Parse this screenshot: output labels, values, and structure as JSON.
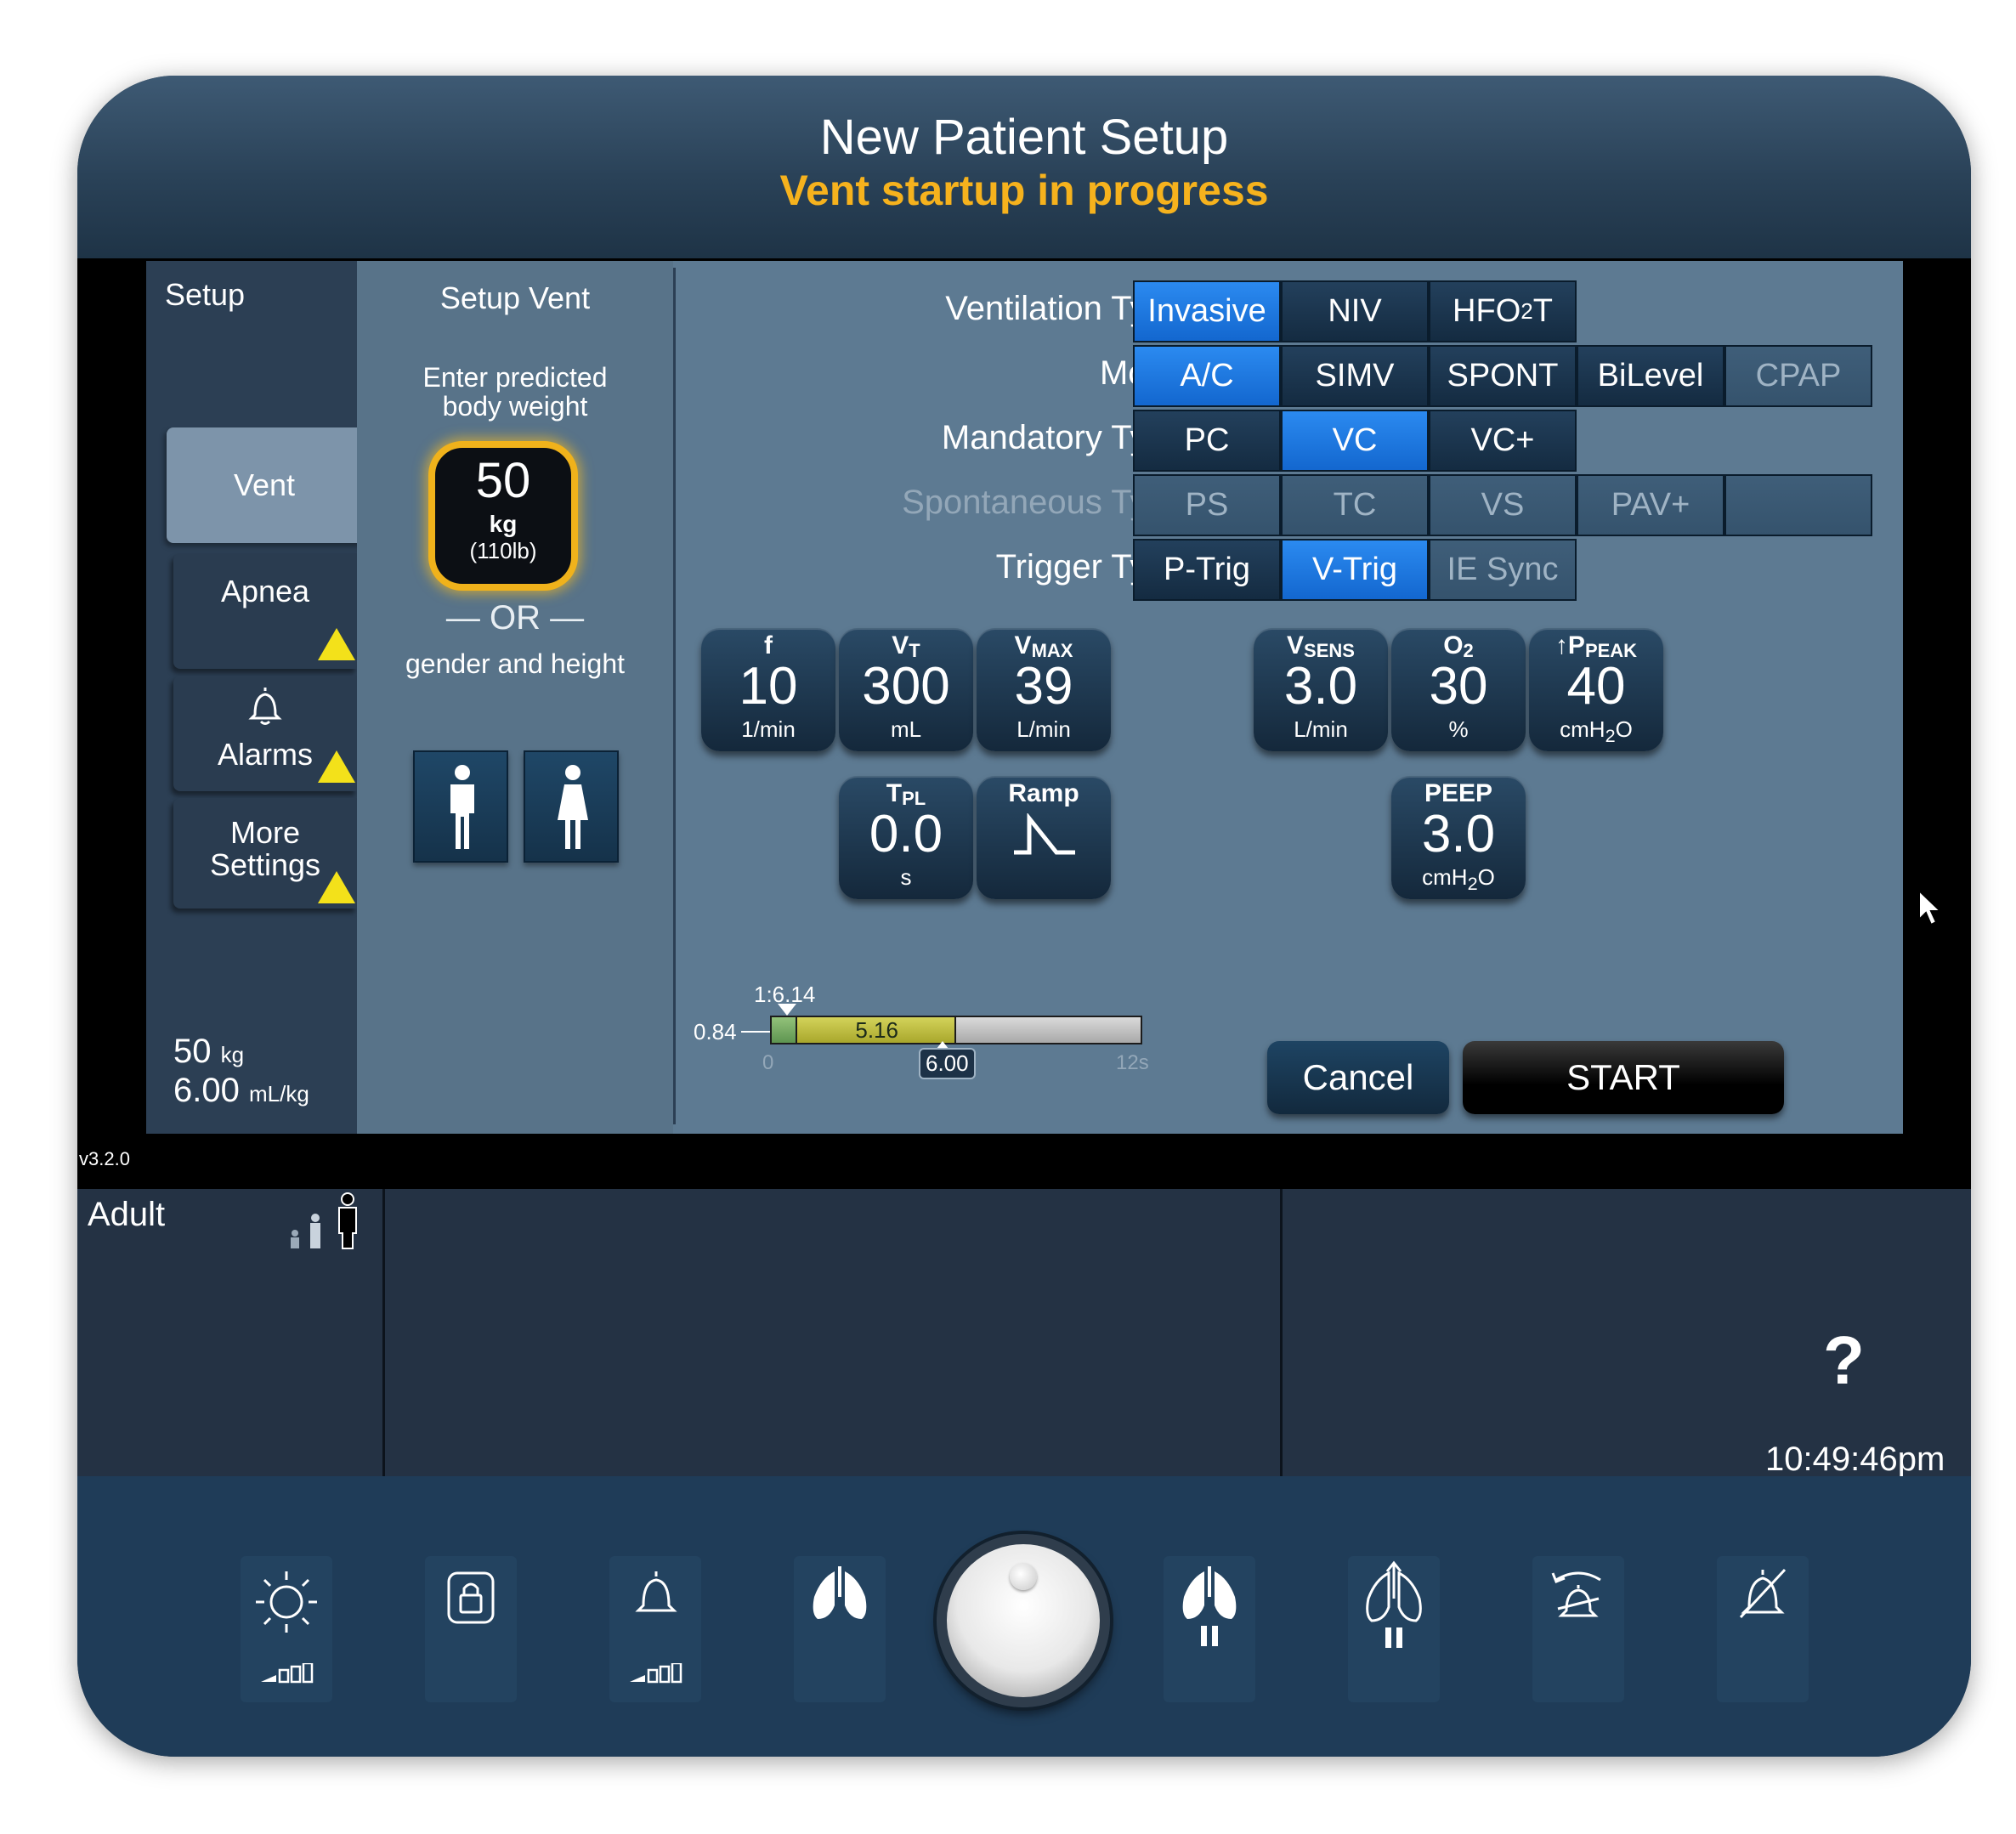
{
  "header": {
    "title": "New Patient Setup",
    "subtitle": "Vent startup in progress"
  },
  "sidebar": {
    "title": "Setup",
    "tabs": [
      {
        "label": "Vent",
        "active": true
      },
      {
        "label": "Apnea",
        "warning": true
      },
      {
        "label": "Alarms",
        "warning": true
      },
      {
        "label": "More Settings",
        "warning": true
      }
    ],
    "weight_value": "50",
    "weight_unit": "kg",
    "vt_per_kg": "6.00",
    "vt_per_kg_unit": "mL/kg"
  },
  "setup_vent": {
    "title": "Setup Vent",
    "prompt": "Enter predicted body weight",
    "weight_value": "50",
    "weight_unit": "kg",
    "weight_lb": "(110lb)",
    "or_text": "— OR —",
    "gender_height": "gender and height"
  },
  "rows": {
    "ventilation_type": {
      "label": "Ventilation Type",
      "options": [
        "Invasive",
        "NIV",
        "HFO2T"
      ],
      "selected": "Invasive"
    },
    "mode": {
      "label": "Mode",
      "options": [
        "A/C",
        "SIMV",
        "SPONT",
        "BiLevel",
        "CPAP"
      ],
      "selected": "A/C"
    },
    "mandatory_type": {
      "label": "Mandatory Type",
      "options": [
        "PC",
        "VC",
        "VC+"
      ],
      "selected": "VC"
    },
    "spontaneous_type": {
      "label": "Spontaneous Type",
      "options": [
        "PS",
        "TC",
        "VS",
        "PAV+",
        ""
      ],
      "disabled": true
    },
    "trigger_type": {
      "label": "Trigger Type",
      "options": [
        "P-Trig",
        "V-Trig",
        "IE Sync"
      ],
      "selected": "V-Trig"
    }
  },
  "settings": {
    "f": {
      "label": "f",
      "value": "10",
      "unit": "1/min"
    },
    "vt": {
      "label": "V",
      "label_sub": "T",
      "value": "300",
      "unit": "mL"
    },
    "vmax": {
      "label": "V",
      "label_sub": "MAX",
      "value": "39",
      "unit": "L/min"
    },
    "vsens": {
      "label": "V",
      "label_sub": "SENS",
      "value": "3.0",
      "unit": "L/min"
    },
    "o2": {
      "label": "O",
      "label_sub": "2",
      "value": "30",
      "unit": "%"
    },
    "ppeak": {
      "label": "↑P",
      "label_sub": "PEAK",
      "value": "40",
      "unit": "cmH",
      "unit_sub": "2",
      "unit_tail": "O"
    },
    "tpl": {
      "label": "T",
      "label_sub": "PL",
      "value": "0.0",
      "unit": "s"
    },
    "ramp": {
      "label": "Ramp"
    },
    "peep": {
      "label": "PEEP",
      "value": "3.0",
      "unit": "cmH",
      "unit_sub": "2",
      "unit_tail": "O"
    }
  },
  "ie_bar": {
    "ratio": "1:6.14",
    "insp": "0.84",
    "exp": "5.16",
    "total": "6.00",
    "axis_start": "0",
    "axis_end": "12s",
    "insp_fraction": 0.07,
    "exp_fraction": 0.43
  },
  "buttons": {
    "cancel": "Cancel",
    "start": "START"
  },
  "version": "v3.2.0",
  "patient_category": "Adult",
  "help": "?",
  "clock": "10:49:46pm",
  "colors": {
    "accent_selected": "#1f78e6",
    "warning": "#f3e11a",
    "subtitle": "#f6b21d"
  },
  "footer_icons": [
    "brightness-icon",
    "screen-lock-icon",
    "alarm-volume-icon",
    "manual-inspiration-icon",
    "main-dial",
    "inspiratory-pause-icon",
    "expiratory-pause-icon",
    "alarm-reset-icon",
    "alarm-silence-icon"
  ]
}
